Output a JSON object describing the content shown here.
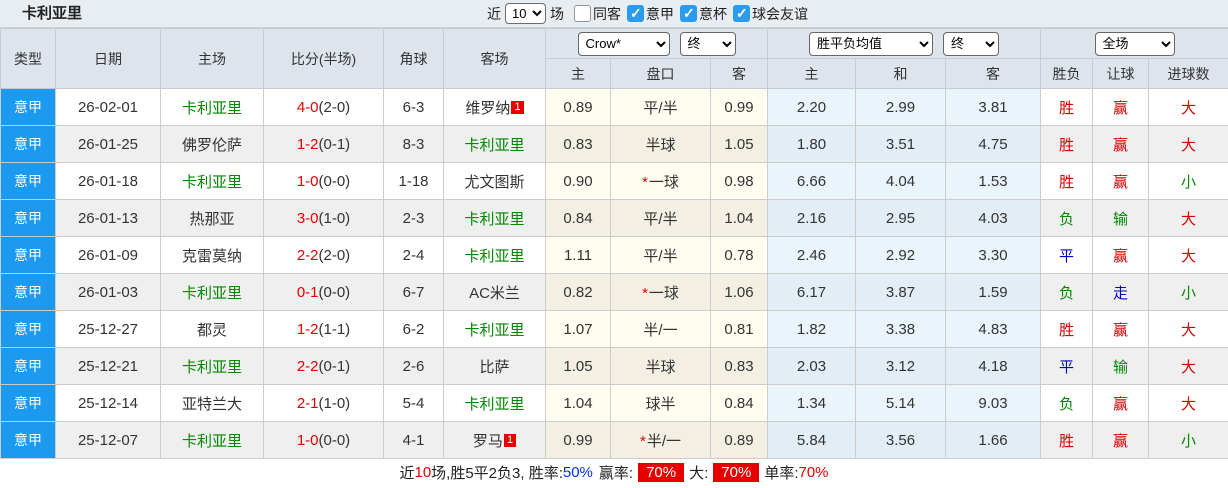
{
  "topbar": {
    "title": "卡利亚里",
    "recent_label": "近",
    "recent_value": "10",
    "matches_label": "场",
    "filters": [
      {
        "label": "同客",
        "checked": false
      },
      {
        "label": "意甲",
        "checked": true
      },
      {
        "label": "意杯",
        "checked": true
      },
      {
        "label": "球会友谊",
        "checked": true
      }
    ]
  },
  "table": {
    "headers": {
      "type": "类型",
      "date": "日期",
      "home": "主场",
      "score": "比分(半场)",
      "corners": "角球",
      "away": "客场",
      "handicap_home": "主",
      "handicap_line": "盘口",
      "handicap_away": "客",
      "avg_home": "主",
      "avg_draw": "和",
      "avg_away": "客",
      "result_wdl": "胜负",
      "result_handicap": "让球",
      "result_goals": "进球数"
    },
    "controls": {
      "company": "Crow*",
      "company_time": "终",
      "avg": "胜平负均值",
      "avg_time": "终",
      "scope": "全场"
    },
    "rows": [
      {
        "league": "意甲",
        "date": "26-02-01",
        "home": "卡利亚里",
        "home_green": true,
        "score": "4-0",
        "half": "(2-0)",
        "corners": "6-3",
        "away": "维罗纳",
        "away_green": false,
        "away_badge": "1",
        "h_home": "0.89",
        "pan": "平/半",
        "pan_star": false,
        "h_away": "0.99",
        "avg_home": "2.20",
        "avg_draw": "2.99",
        "avg_away": "3.81",
        "wdl": "胜",
        "wdl_c": "red",
        "let": "赢",
        "let_c": "red",
        "big": "大",
        "big_c": "red"
      },
      {
        "league": "意甲",
        "date": "26-01-25",
        "home": "佛罗伦萨",
        "home_green": false,
        "score": "1-2",
        "half": "(0-1)",
        "corners": "8-3",
        "away": "卡利亚里",
        "away_green": true,
        "h_home": "0.83",
        "pan": "半球",
        "pan_star": false,
        "h_away": "1.05",
        "avg_home": "1.80",
        "avg_draw": "3.51",
        "avg_away": "4.75",
        "wdl": "胜",
        "wdl_c": "red",
        "let": "赢",
        "let_c": "red",
        "big": "大",
        "big_c": "red"
      },
      {
        "league": "意甲",
        "date": "26-01-18",
        "home": "卡利亚里",
        "home_green": true,
        "score": "1-0",
        "half": "(0-0)",
        "corners": "1-18",
        "away": "尤文图斯",
        "away_green": false,
        "h_home": "0.90",
        "pan": "一球",
        "pan_star": true,
        "h_away": "0.98",
        "avg_home": "6.66",
        "avg_draw": "4.04",
        "avg_away": "1.53",
        "wdl": "胜",
        "wdl_c": "red",
        "let": "赢",
        "let_c": "red",
        "big": "小",
        "big_c": "green"
      },
      {
        "league": "意甲",
        "date": "26-01-13",
        "home": "热那亚",
        "home_green": false,
        "score": "3-0",
        "half": "(1-0)",
        "corners": "2-3",
        "away": "卡利亚里",
        "away_green": true,
        "h_home": "0.84",
        "pan": "平/半",
        "pan_star": false,
        "h_away": "1.04",
        "avg_home": "2.16",
        "avg_draw": "2.95",
        "avg_away": "4.03",
        "wdl": "负",
        "wdl_c": "green",
        "let": "输",
        "let_c": "green",
        "big": "大",
        "big_c": "red"
      },
      {
        "league": "意甲",
        "date": "26-01-09",
        "home": "克雷莫纳",
        "home_green": false,
        "score": "2-2",
        "half": "(2-0)",
        "corners": "2-4",
        "away": "卡利亚里",
        "away_green": true,
        "h_home": "1.11",
        "pan": "平/半",
        "pan_star": false,
        "h_away": "0.78",
        "avg_home": "2.46",
        "avg_draw": "2.92",
        "avg_away": "3.30",
        "wdl": "平",
        "wdl_c": "blue",
        "let": "赢",
        "let_c": "red",
        "big": "大",
        "big_c": "red"
      },
      {
        "league": "意甲",
        "date": "26-01-03",
        "home": "卡利亚里",
        "home_green": true,
        "score": "0-1",
        "half": "(0-0)",
        "corners": "6-7",
        "away": "AC米兰",
        "away_green": false,
        "h_home": "0.82",
        "pan": "一球",
        "pan_star": true,
        "h_away": "1.06",
        "avg_home": "6.17",
        "avg_draw": "3.87",
        "avg_away": "1.59",
        "wdl": "负",
        "wdl_c": "green",
        "let": "走",
        "let_c": "blue",
        "big": "小",
        "big_c": "green"
      },
      {
        "league": "意甲",
        "date": "25-12-27",
        "home": "都灵",
        "home_green": false,
        "score": "1-2",
        "half": "(1-1)",
        "corners": "6-2",
        "away": "卡利亚里",
        "away_green": true,
        "h_home": "1.07",
        "pan": "半/一",
        "pan_star": false,
        "h_away": "0.81",
        "avg_home": "1.82",
        "avg_draw": "3.38",
        "avg_away": "4.83",
        "wdl": "胜",
        "wdl_c": "red",
        "let": "赢",
        "let_c": "red",
        "big": "大",
        "big_c": "red"
      },
      {
        "league": "意甲",
        "date": "25-12-21",
        "home": "卡利亚里",
        "home_green": true,
        "score": "2-2",
        "half": "(0-1)",
        "corners": "2-6",
        "away": "比萨",
        "away_green": false,
        "h_home": "1.05",
        "pan": "半球",
        "pan_star": false,
        "h_away": "0.83",
        "avg_home": "2.03",
        "avg_draw": "3.12",
        "avg_away": "4.18",
        "wdl": "平",
        "wdl_c": "blue",
        "let": "输",
        "let_c": "green",
        "big": "大",
        "big_c": "red"
      },
      {
        "league": "意甲",
        "date": "25-12-14",
        "home": "亚特兰大",
        "home_green": false,
        "score": "2-1",
        "half": "(1-0)",
        "corners": "5-4",
        "away": "卡利亚里",
        "away_green": true,
        "h_home": "1.04",
        "pan": "球半",
        "pan_star": false,
        "h_away": "0.84",
        "avg_home": "1.34",
        "avg_draw": "5.14",
        "avg_away": "9.03",
        "wdl": "负",
        "wdl_c": "green",
        "let": "赢",
        "let_c": "red",
        "big": "大",
        "big_c": "red"
      },
      {
        "league": "意甲",
        "date": "25-12-07",
        "home": "卡利亚里",
        "home_green": true,
        "score": "1-0",
        "half": "(0-0)",
        "corners": "4-1",
        "away": "罗马",
        "away_green": false,
        "away_badge": "1",
        "h_home": "0.99",
        "pan": "半/一",
        "pan_star": true,
        "h_away": "0.89",
        "avg_home": "5.84",
        "avg_draw": "3.56",
        "avg_away": "1.66",
        "wdl": "胜",
        "wdl_c": "red",
        "let": "赢",
        "let_c": "red",
        "big": "小",
        "big_c": "green"
      }
    ]
  },
  "summary": {
    "prefix": "近",
    "count": "10",
    "record": "场,胜5平2负3, 胜率:",
    "win_rate": "50%",
    "asian_label": "赢率:",
    "asian_rate": "70%",
    "big_label": "大:",
    "big_rate": "70%",
    "single_label": "单率:",
    "single_rate": "70%"
  },
  "colors": {
    "league_cell": "#1b9af0",
    "team_highlight": "#008800",
    "score_main": "#e60000",
    "result_win": "#d40000",
    "result_lose": "#008800",
    "result_draw": "#0000cc",
    "handicap_bg": "#fffcf0",
    "avg_bg": "#eaf4fb",
    "rate_box_bg": "#e60000",
    "win_rate_text": "#0033ee"
  }
}
